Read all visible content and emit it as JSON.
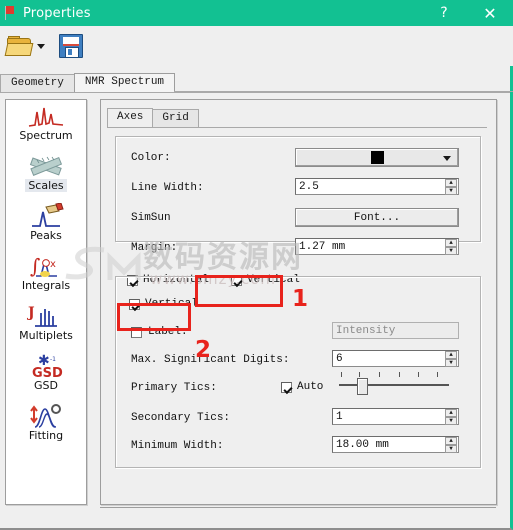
{
  "window": {
    "title": "Properties",
    "icon": "properties-app-icon",
    "help_label": "?",
    "close_label": "✕",
    "accent_color": "#12c192"
  },
  "toolbar": {
    "open_icon": "open-folder-icon",
    "open_dropdown_icon": "chevron-down-icon",
    "save_icon": "floppy-disk-save-icon"
  },
  "outer_tabs": [
    {
      "label": "Geometry",
      "active": false
    },
    {
      "label": "NMR Spectrum",
      "active": true
    }
  ],
  "sidebar": {
    "items": [
      {
        "label": "Spectrum",
        "icon": "spectrum-icon",
        "selected": false
      },
      {
        "label": "Scales",
        "icon": "scales-ruler-icon",
        "selected": true
      },
      {
        "label": "Peaks",
        "icon": "peaks-icon",
        "selected": false
      },
      {
        "label": "Integrals",
        "icon": "integrals-icon",
        "selected": false
      },
      {
        "label": "Multiplets",
        "icon": "multiplets-icon",
        "selected": false
      },
      {
        "label": "GSD",
        "icon": "gsd-icon",
        "selected": false
      },
      {
        "label": "Fitting",
        "icon": "fitting-icon",
        "selected": false
      }
    ]
  },
  "panel": {
    "inner_tabs": [
      {
        "label": "Axes",
        "active": true
      },
      {
        "label": "Grid",
        "active": false
      }
    ],
    "axes_group": {
      "color": {
        "label": "Color:",
        "value_swatch": "#000000",
        "dropdown_icon": "chevron-down-icon"
      },
      "line_width": {
        "label": "Line Width:",
        "value": "2.5"
      },
      "font": {
        "label": "SimSun",
        "button_label": "Font..."
      },
      "margin": {
        "label": "Margin:",
        "value": "1.27 mm"
      }
    },
    "orientation": {
      "horizontal": {
        "label": "Horizontal",
        "checked": true
      },
      "vertical": {
        "label": "Vertical",
        "checked": true
      }
    },
    "axis_group": {
      "label_checkbox": {
        "label": "Label:",
        "checked": false
      },
      "label_value": {
        "value": "Intensity",
        "placeholder": "Intensity",
        "disabled": true
      },
      "max_significant_digits": {
        "label": "Max. Significant Digits:",
        "value": "6"
      },
      "primary_tics": {
        "label": "Primary Tics:",
        "auto_label": "Auto",
        "auto_checked": true,
        "slider_value": 18
      },
      "secondary_tics": {
        "label": "Secondary Tics:",
        "value": "1"
      },
      "minimum_width": {
        "label": "Minimum Width:",
        "value": "18.00 mm"
      }
    }
  },
  "annotations": {
    "color": "#e8231c",
    "marker_1": "1",
    "marker_2": "2"
  },
  "watermark": {
    "chinese": "数码资源网",
    "url": "www.smzy.com",
    "logo": "sm-logo"
  }
}
